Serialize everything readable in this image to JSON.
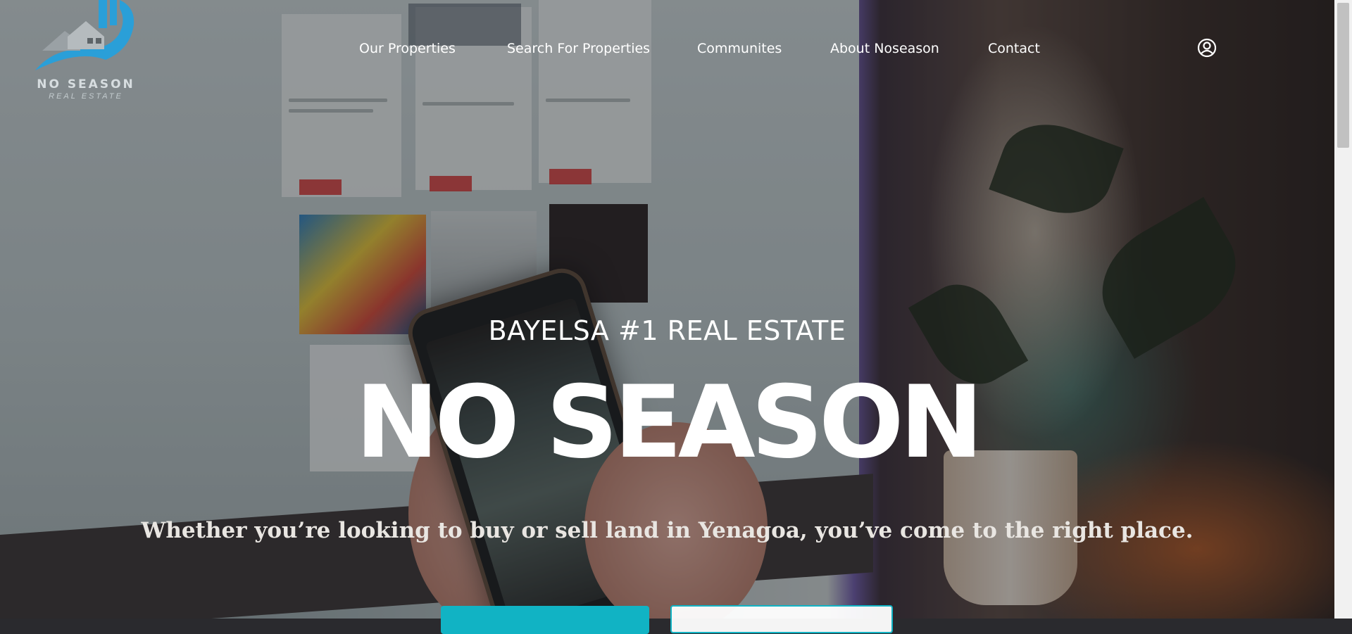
{
  "brand": {
    "name": "NO SEASON",
    "subtitle": "REAL ESTATE",
    "accent_color": "#11b3c4",
    "logo_blue": "#2a9fd8"
  },
  "nav": {
    "items": [
      {
        "label": "Our Properties"
      },
      {
        "label": "Search For Properties"
      },
      {
        "label": "Communites"
      },
      {
        "label": "About Noseason"
      },
      {
        "label": "Contact"
      }
    ],
    "account_icon": "user-circle-icon"
  },
  "hero": {
    "kicker": "BAYELSA #1 REAL ESTATE",
    "headline": "NO SEASON",
    "tagline": "Whether you’re looking to buy or sell land in Yenagoa, you’ve come to the right place."
  }
}
